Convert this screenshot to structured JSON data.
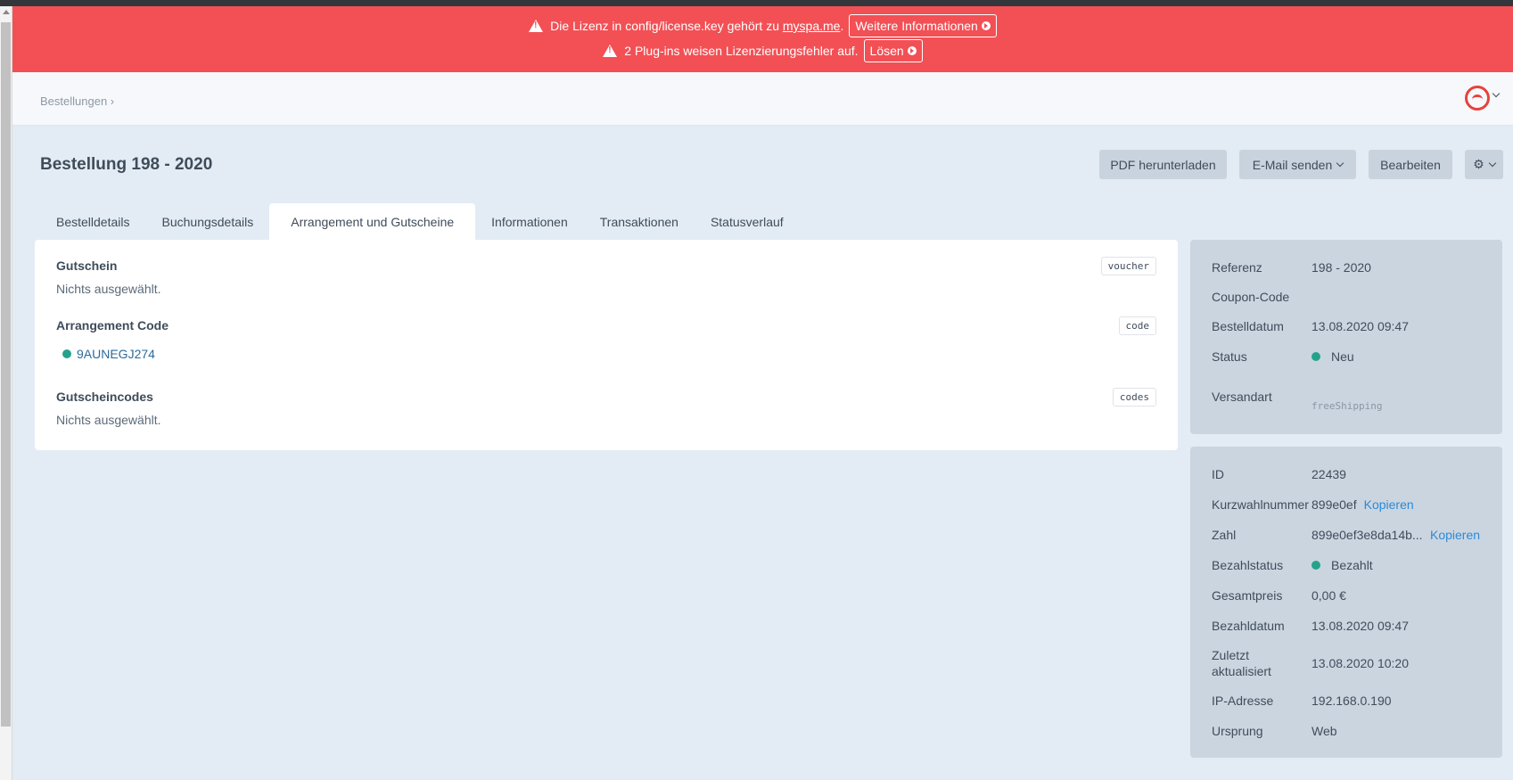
{
  "banner": {
    "line1_text": "Die Lizenz in config/license.key gehört zu",
    "line1_link": "myspa.me",
    "line1_suffix": ".",
    "line1_button": "Weitere Informationen",
    "line2_text": "2 Plug-ins weisen Lizenzierungsfehler auf.",
    "line2_button": "Lösen"
  },
  "breadcrumb": "Bestellungen ›",
  "page_title": "Bestellung 198 - 2020",
  "actions": {
    "pdf": "PDF herunterladen",
    "email": "E-Mail senden",
    "edit": "Bearbeiten",
    "settings_icon": "gear-icon"
  },
  "tabs": [
    {
      "label": "Bestelldetails"
    },
    {
      "label": "Buchungsdetails"
    },
    {
      "label": "Arrangement und Gutscheine"
    },
    {
      "label": "Informationen"
    },
    {
      "label": "Transaktionen"
    },
    {
      "label": "Statusverlauf"
    }
  ],
  "main": {
    "voucher_title": "Gutschein",
    "voucher_tag": "voucher",
    "voucher_text": "Nichts ausgewählt.",
    "arrangement_title": "Arrangement Code",
    "arrangement_tag": "code",
    "arrangement_code": "9AUNEGJ274",
    "codes_title": "Gutscheincodes",
    "codes_tag": "codes",
    "codes_text": "Nichts ausgewählt."
  },
  "summary": {
    "referenz_label": "Referenz",
    "referenz_value": "198 - 2020",
    "coupon_label": "Coupon-Code",
    "date_label": "Bestelldatum",
    "date_value": "13.08.2020 09:47",
    "status_label": "Status",
    "status_value": "Neu",
    "shipping_label": "Versandart",
    "shipping_value": "freeShipping"
  },
  "payment": {
    "id_label": "ID",
    "id_value": "22439",
    "short_label": "Kurzwahlnummer",
    "short_value": "899e0ef",
    "copy_label": "Kopieren",
    "number_label": "Zahl",
    "number_value": "899e0ef3e8da14b...",
    "paystatus_label": "Bezahlstatus",
    "paystatus_value": "Bezahlt",
    "total_label": "Gesamtpreis",
    "total_value": "0,00 €",
    "paydate_label": "Bezahldatum",
    "paydate_value": "13.08.2020 09:47",
    "updated_label_1": "Zuletzt",
    "updated_label_2": "aktualisiert",
    "updated_value": "13.08.2020 10:20",
    "ip_label": "IP-Adresse",
    "ip_value": "192.168.0.190",
    "origin_label": "Ursprung",
    "origin_value": "Web"
  },
  "colors": {
    "banner": "#f25055",
    "status_dot": "#25a28c",
    "link": "#2b8bd8"
  }
}
